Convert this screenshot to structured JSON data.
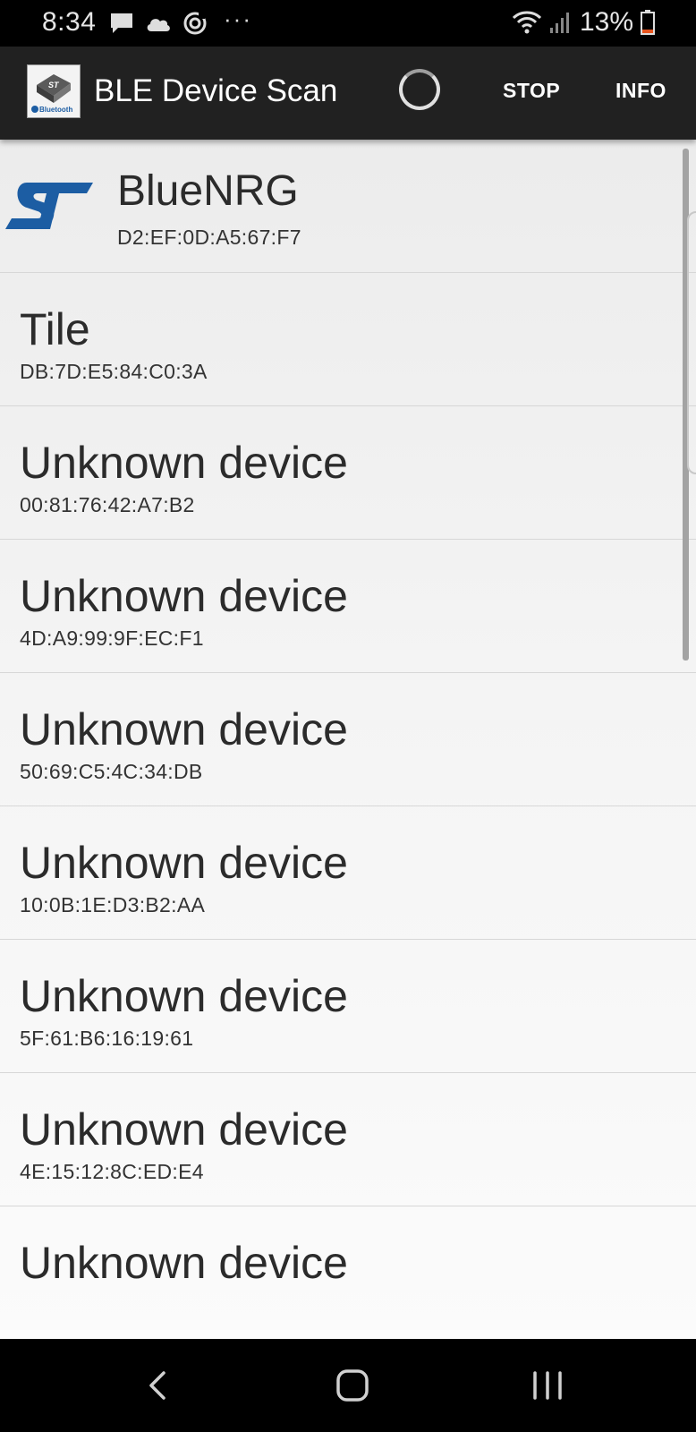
{
  "status_bar": {
    "time": "8:34",
    "icons_left": [
      "message-icon",
      "cloud-icon",
      "sync-icon"
    ],
    "overflow": "···",
    "battery_percent": "13%",
    "battery_color": "#e8551e"
  },
  "app_bar": {
    "title": "BLE Device Scan",
    "logo_text": "Bluetooth",
    "stop_label": "STOP",
    "info_label": "INFO",
    "background": "#212121"
  },
  "devices": [
    {
      "name": "BlueNRG",
      "address": "D2:EF:0D:A5:67:F7",
      "has_st_logo": true
    },
    {
      "name": "Tile",
      "address": "DB:7D:E5:84:C0:3A"
    },
    {
      "name": "Unknown device",
      "address": "00:81:76:42:A7:B2"
    },
    {
      "name": "Unknown device",
      "address": "4D:A9:99:9F:EC:F1"
    },
    {
      "name": "Unknown device",
      "address": "50:69:C5:4C:34:DB"
    },
    {
      "name": "Unknown device",
      "address": "10:0B:1E:D3:B2:AA"
    },
    {
      "name": "Unknown device",
      "address": "5F:61:B6:16:19:61"
    },
    {
      "name": "Unknown device",
      "address": "4E:15:12:8C:ED:E4"
    },
    {
      "name": "Unknown device",
      "address": ""
    }
  ],
  "colors": {
    "st_logo": "#1c5da3"
  },
  "nav_bar": {
    "buttons": [
      "back-icon",
      "home-icon",
      "recents-icon"
    ]
  }
}
